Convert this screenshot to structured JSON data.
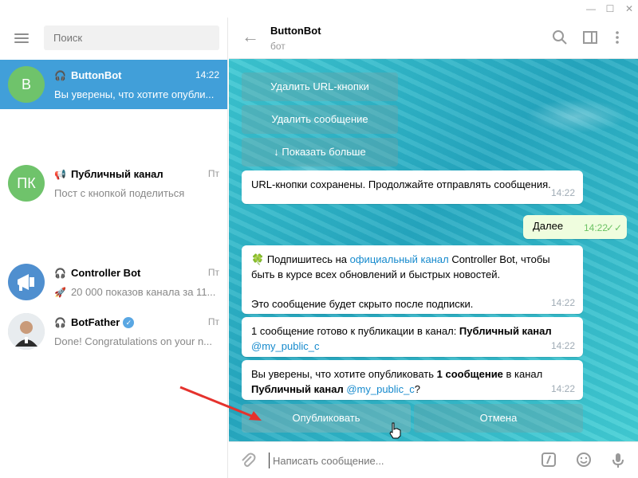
{
  "window": {
    "min": "—",
    "max": "☐",
    "close": "✕"
  },
  "sidebar": {
    "search_placeholder": "Поиск",
    "chats": [
      {
        "avatar": "B",
        "title": "ButtonBot",
        "time": "14:22",
        "preview": "Вы уверены, что хотите опубли...",
        "active": true,
        "color": "#6fc36b"
      },
      {
        "avatar": "ПК",
        "title": "Публичный канал",
        "time": "Пт",
        "preview": "Пост с кнопкой поделиться",
        "color": "#6fc36b"
      },
      {
        "avatar": "",
        "title": "Controller Bot",
        "time": "Пт",
        "preview": "20 000 показов канала за 11...",
        "color": "#4f8fcf"
      },
      {
        "avatar": "",
        "title": "BotFather",
        "time": "Пт",
        "preview": "Done! Congratulations on your n...",
        "color": "#ddd"
      }
    ]
  },
  "header": {
    "title": "ButtonBot",
    "subtitle": "бот"
  },
  "keyboard_top": [
    "Удалить URL-кнопки",
    "Удалить сообщение",
    "↓ Показать больше"
  ],
  "messages": {
    "m1": {
      "text": "URL-кнопки сохранены. Продолжайте отправлять сообщения.",
      "time": "14:22"
    },
    "m2": {
      "text": "Далее",
      "time": "14:22",
      "check": "✓✓"
    },
    "m3": {
      "p1_a": "Подпишитесь на ",
      "p1_link": "официальный канал",
      "p1_b": " Controller Bot, чтобы быть в курсе всех обновлений и быстрых новостей.",
      "p2": "Это сообщение будет скрыто после подписки.",
      "time": "14:22"
    },
    "m4": {
      "a": "1 сообщение готово к публикации в канал: ",
      "b": "Публичный канал",
      "link": "@my_public_c",
      "time": "14:22"
    },
    "m5": {
      "a": "Вы уверены, что хотите опубликовать ",
      "b": "1 сообщение",
      "c": " в канал ",
      "d": "Публичный канал",
      "link": "@my_public_c",
      "e": "?",
      "time": "14:22"
    }
  },
  "keyboard_bottom": {
    "publish": "Опубликовать",
    "cancel": "Отмена"
  },
  "composer": {
    "placeholder": "Написать сообщение..."
  }
}
